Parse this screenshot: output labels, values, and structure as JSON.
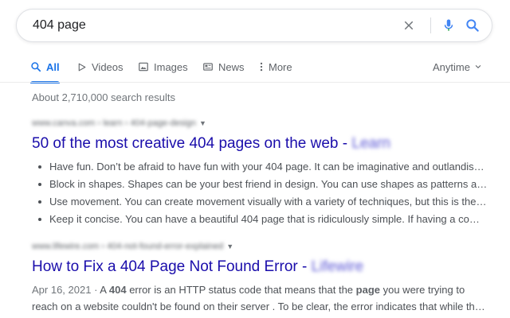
{
  "search": {
    "query": "404 page"
  },
  "tabs": [
    {
      "label": "All",
      "icon": "search-icon"
    },
    {
      "label": "Videos",
      "icon": "play-icon"
    },
    {
      "label": "Images",
      "icon": "image-icon"
    },
    {
      "label": "News",
      "icon": "newspaper-icon"
    },
    {
      "label": "More",
      "icon": "more-vert-icon"
    }
  ],
  "tools": {
    "anytime": "Anytime"
  },
  "stats": "About 2,710,000 search results",
  "results": [
    {
      "cite": "www.canva.com › learn › 404-page-design",
      "title": "50 of the most creative 404 pages on the web",
      "title_sep": " - ",
      "title_site": "Learn",
      "bullets": [
        "Have fun. Don’t be afraid to have fun with your 404 page. It can be imaginative and outlandish …",
        "Block in shapes. Shapes can be your best friend in design. You can use shapes as patterns an…",
        "Use movement. You can create movement visually with a variety of techniques, but this is the …",
        "Keep it concise. You can have a beautiful 404 page that is ridiculously simple. If having a comp…"
      ]
    },
    {
      "cite": "www.lifewire.com › 404-not-found-error-explained",
      "title": "How to Fix a 404 Page Not Found Error",
      "title_sep": " - ",
      "title_site": "Lifewire",
      "snippet": {
        "date": "Apr 16, 2021",
        "date_sep": " · ",
        "l1_a": "A ",
        "l1_b1": "404",
        "l1_c": " error is an HTTP status code that means that the ",
        "l1_b2": "page",
        "l1_d": " you were trying to",
        "l2": "reach on a website couldn't be found on their server . To be clear, the error indicates that while the…"
      }
    }
  ],
  "colors": {
    "accent": "#1a73e8",
    "link": "#1a0dab",
    "text": "#4d5156",
    "muted": "#70757a"
  }
}
